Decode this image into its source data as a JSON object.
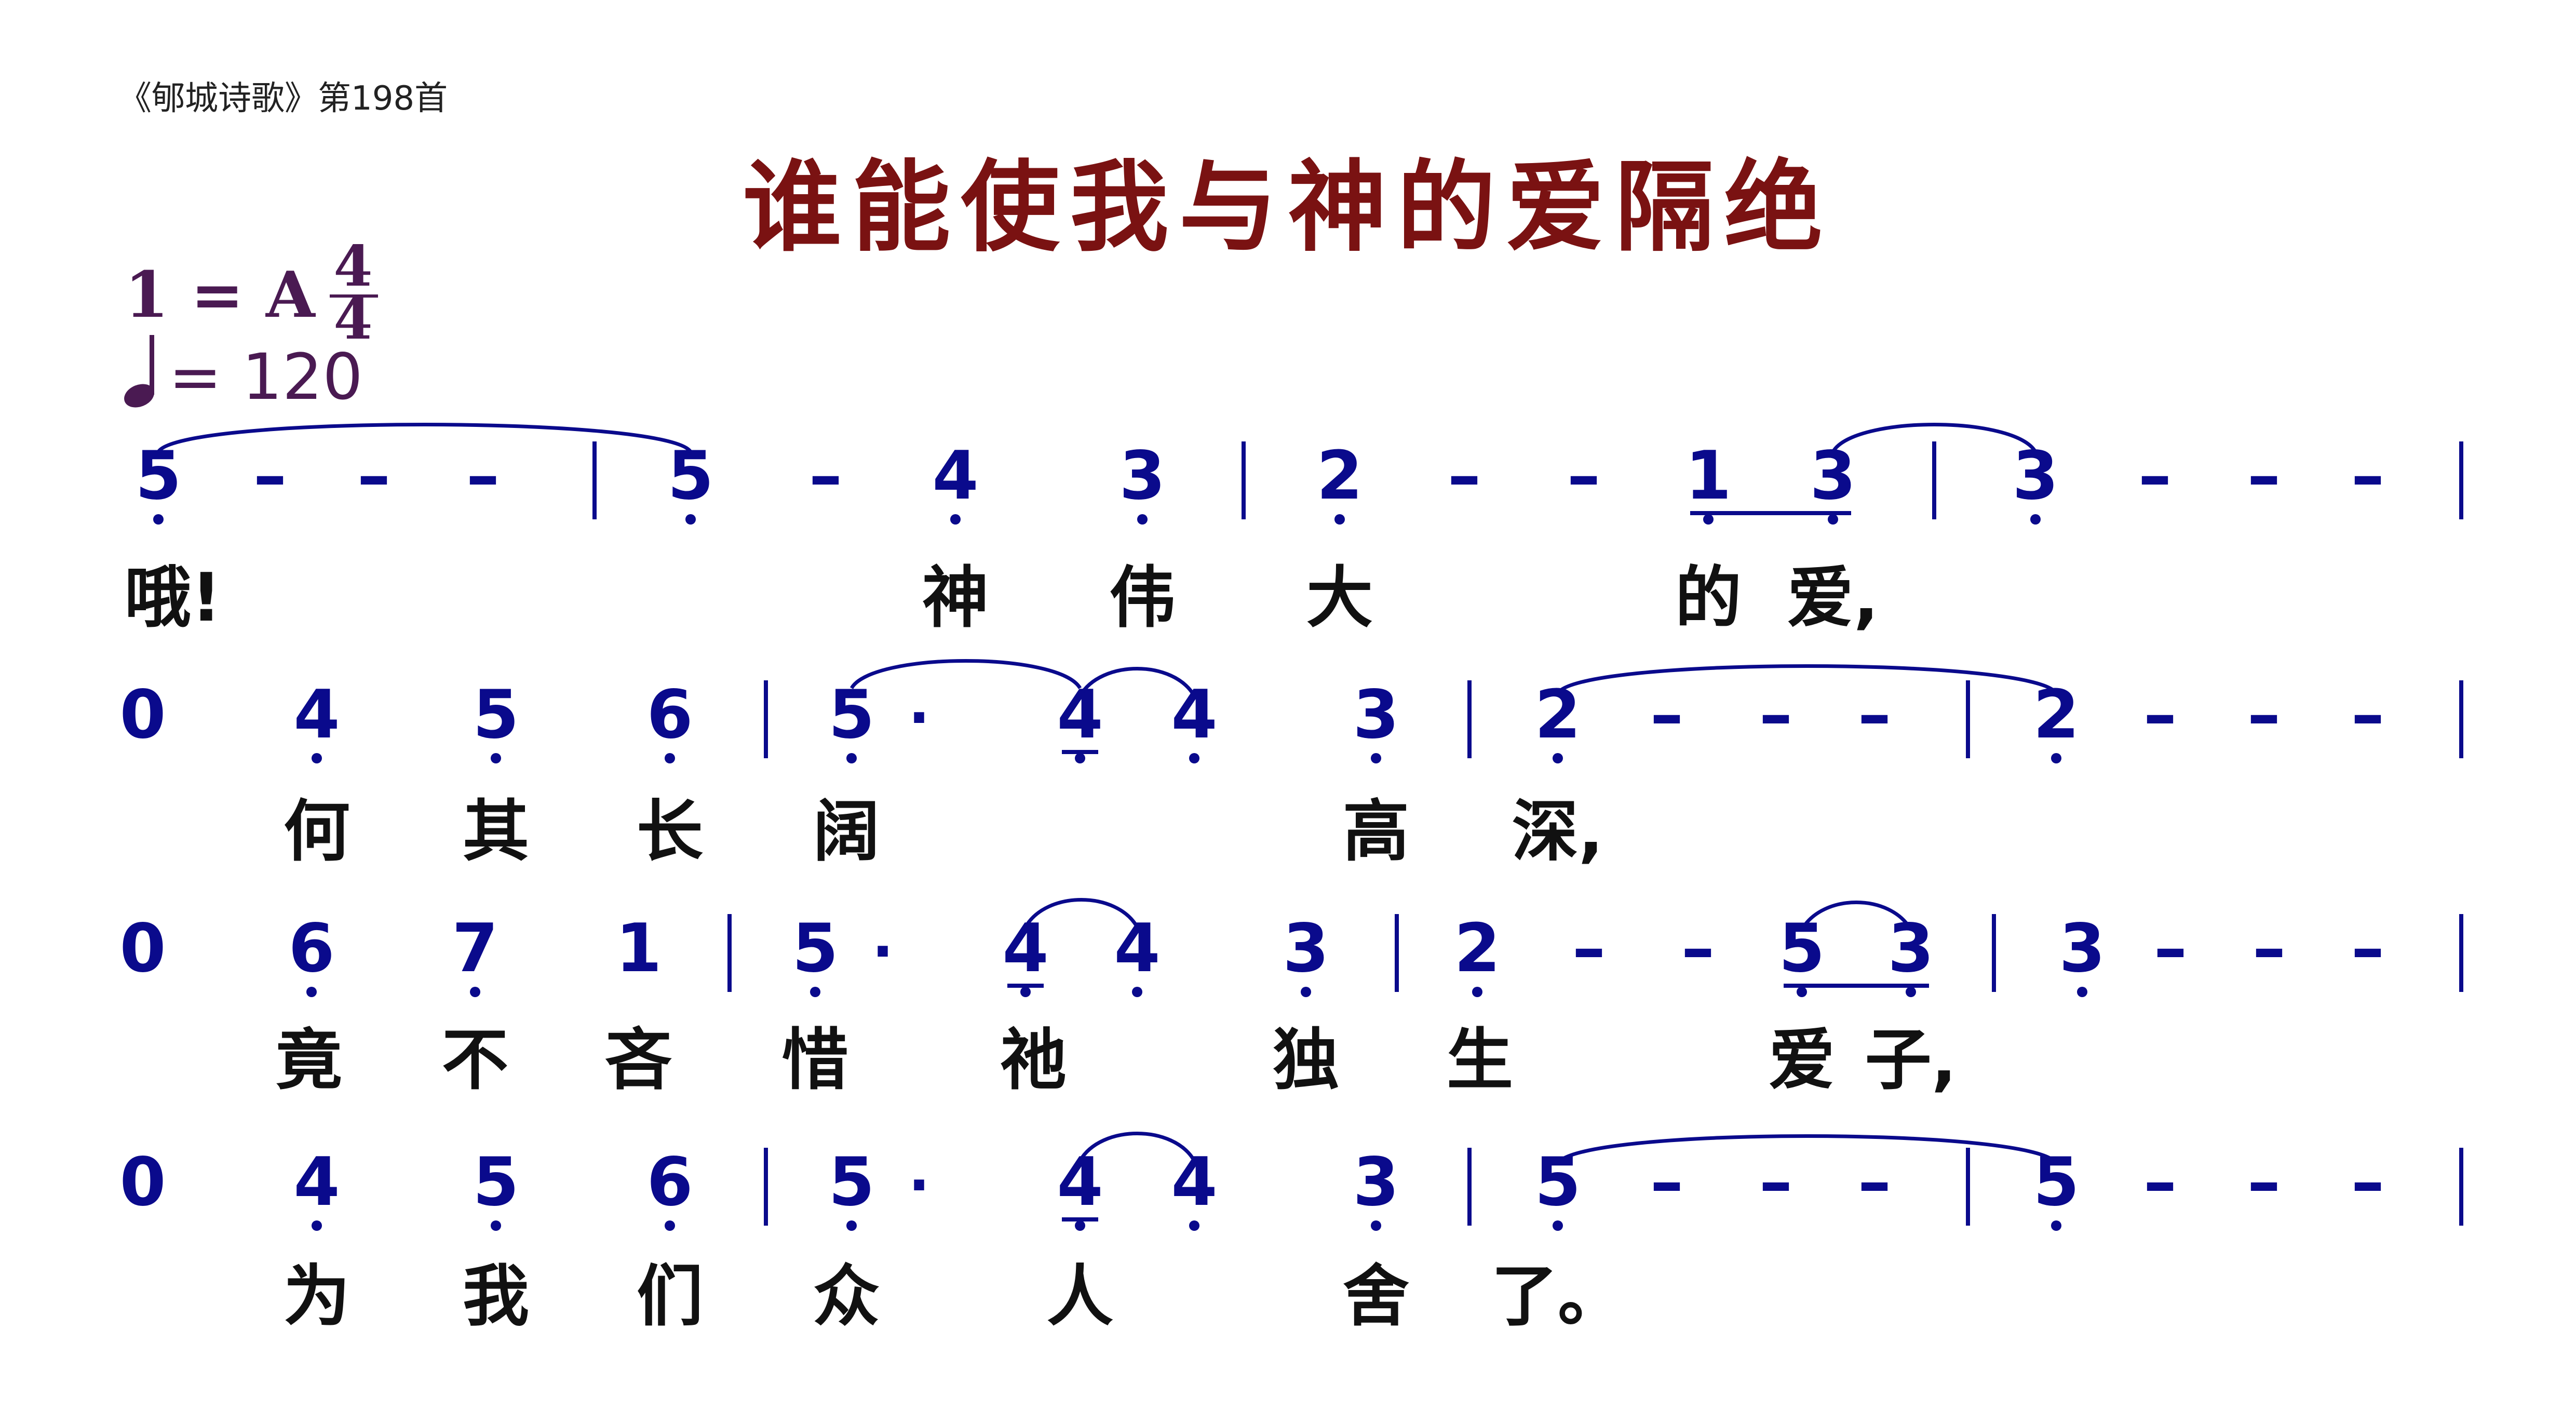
{
  "header": {
    "source": "《郇城诗歌》第198首",
    "title": "谁能使我与神的爱隔绝",
    "key": "1 = A",
    "time_top": "4",
    "time_bottom": "4",
    "tempo": "= 120"
  },
  "colors": {
    "notes": "#0a0a8c",
    "lyrics": "#111111",
    "title": "#7a1212",
    "meta": "#4a1a52"
  },
  "music": {
    "lines": [
      {
        "tokens": [
          {
            "text": "5",
            "dotBelow": true
          },
          {
            "text": "-"
          },
          {
            "text": "-"
          },
          {
            "text": "-"
          },
          {
            "text": "5",
            "dotBelow": true
          },
          {
            "text": "-"
          },
          {
            "text": "4",
            "dotBelow": true
          },
          {
            "text": "3",
            "dotBelow": true
          },
          {
            "text": "2",
            "dotBelow": true
          },
          {
            "text": "-"
          },
          {
            "text": "-"
          },
          {
            "text": "1",
            "dotBelow": true
          },
          {
            "text": "3",
            "dotBelow": true
          },
          {
            "text": "3",
            "dotBelow": true
          },
          {
            "text": "-"
          },
          {
            "text": "-"
          },
          {
            "text": "-"
          }
        ],
        "lyrics": [
          "哦!",
          "神",
          "伟",
          "大",
          "的",
          "爱,"
        ]
      },
      {
        "tokens": [
          {
            "text": "0"
          },
          {
            "text": "4",
            "dotBelow": true
          },
          {
            "text": "5",
            "dotBelow": true
          },
          {
            "text": "6",
            "dotBelow": true
          },
          {
            "text": "5",
            "dotBelow": true
          },
          {
            "text": "·"
          },
          {
            "text": "4",
            "dotBelow": true
          },
          {
            "text": "4",
            "dotBelow": true
          },
          {
            "text": "3",
            "dotBelow": true
          },
          {
            "text": "2",
            "dotBelow": true
          },
          {
            "text": "-"
          },
          {
            "text": "-"
          },
          {
            "text": "-"
          },
          {
            "text": "2",
            "dotBelow": true
          },
          {
            "text": "-"
          },
          {
            "text": "-"
          },
          {
            "text": "-"
          }
        ],
        "lyrics": [
          "何",
          "其",
          "长",
          "阔",
          "高",
          "深,"
        ]
      },
      {
        "tokens": [
          {
            "text": "0"
          },
          {
            "text": "6",
            "dotBelow": true
          },
          {
            "text": "7",
            "dotBelow": true
          },
          {
            "text": "1"
          },
          {
            "text": "5",
            "dotBelow": true
          },
          {
            "text": "·"
          },
          {
            "text": "4",
            "dotBelow": true
          },
          {
            "text": "4",
            "dotBelow": true
          },
          {
            "text": "3",
            "dotBelow": true
          },
          {
            "text": "2",
            "dotBelow": true
          },
          {
            "text": "-"
          },
          {
            "text": "-"
          },
          {
            "text": "5",
            "dotBelow": true
          },
          {
            "text": "3",
            "dotBelow": true
          },
          {
            "text": "3",
            "dotBelow": true
          },
          {
            "text": "-"
          },
          {
            "text": "-"
          },
          {
            "text": "-"
          }
        ],
        "lyrics": [
          "竟",
          "不",
          "吝",
          "惜",
          "祂",
          "独",
          "生",
          "爱",
          "子,"
        ]
      },
      {
        "tokens": [
          {
            "text": "0"
          },
          {
            "text": "4",
            "dotBelow": true
          },
          {
            "text": "5",
            "dotBelow": true
          },
          {
            "text": "6",
            "dotBelow": true
          },
          {
            "text": "5",
            "dotBelow": true
          },
          {
            "text": "·"
          },
          {
            "text": "4",
            "dotBelow": true
          },
          {
            "text": "4",
            "dotBelow": true
          },
          {
            "text": "3",
            "dotBelow": true
          },
          {
            "text": "5",
            "dotBelow": true
          },
          {
            "text": "-"
          },
          {
            "text": "-"
          },
          {
            "text": "-"
          },
          {
            "text": "5",
            "dotBelow": true
          },
          {
            "text": "-"
          },
          {
            "text": "-"
          },
          {
            "text": "-"
          }
        ],
        "lyrics": [
          "为",
          "我",
          "们",
          "众",
          "人",
          "舍",
          "了。"
        ]
      }
    ]
  }
}
